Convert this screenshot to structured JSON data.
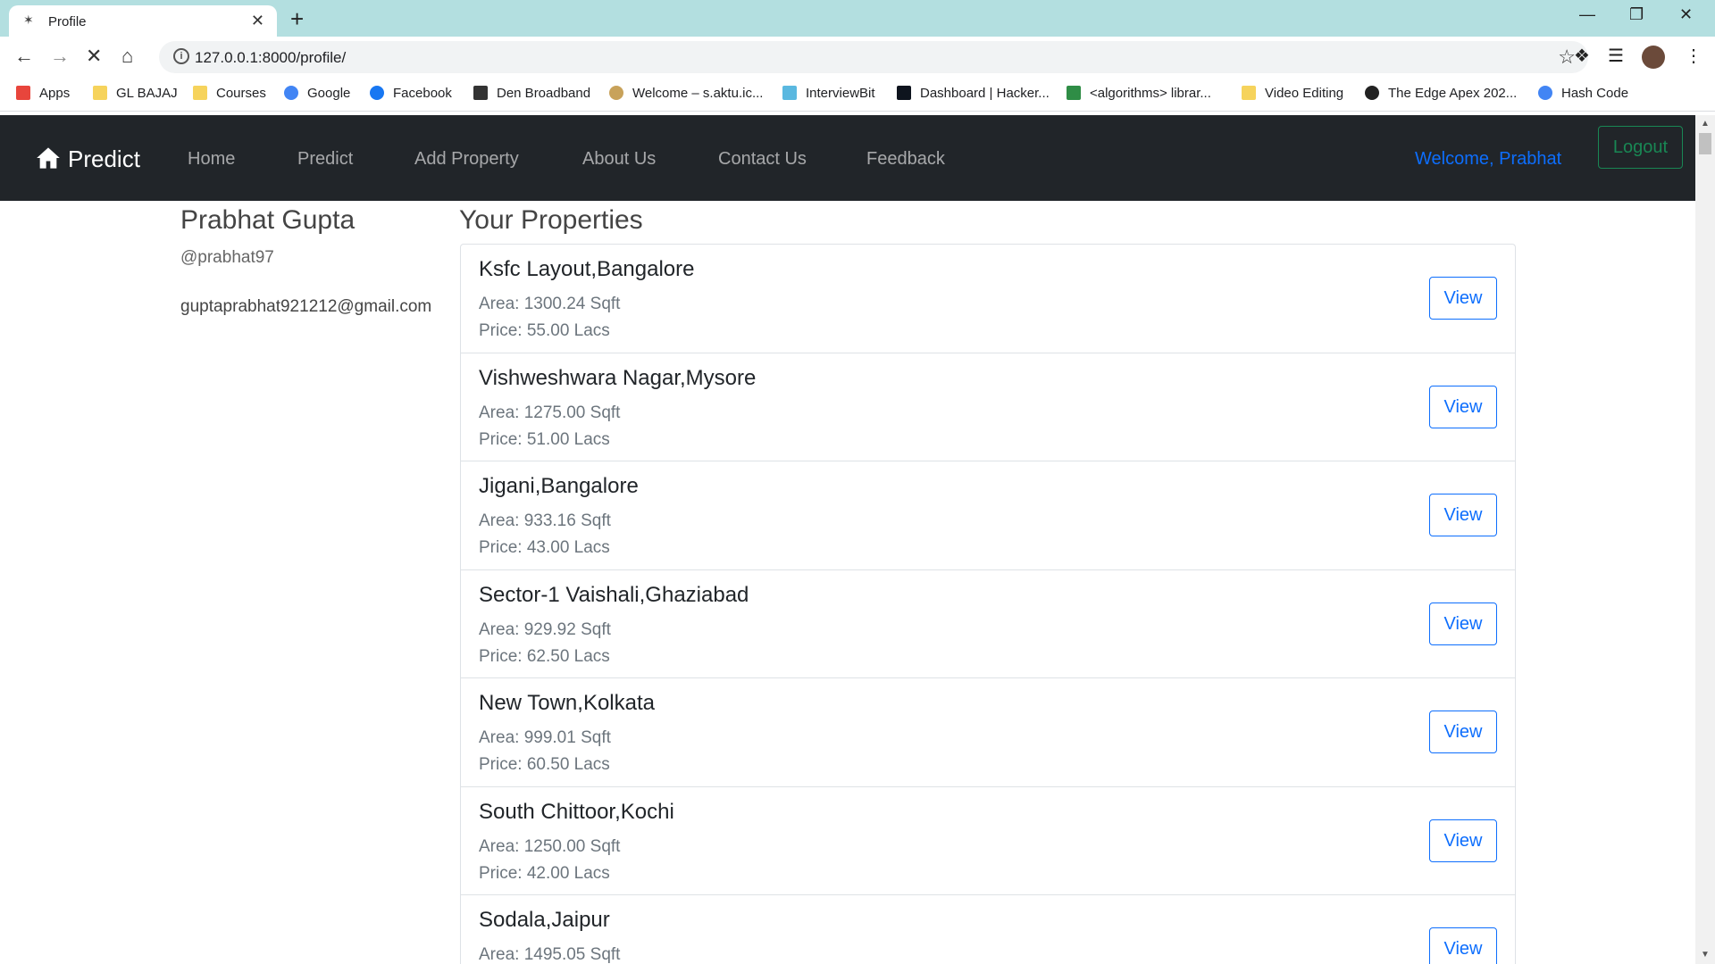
{
  "browser": {
    "tab_title": "Profile",
    "new_tab_glyph": "+",
    "url": "127.0.0.1:8000/profile/",
    "bookmarks": [
      {
        "label": "Apps",
        "icon": "apps-grid-icon"
      },
      {
        "label": "GL BAJAJ",
        "icon": "folder-icon"
      },
      {
        "label": "Courses",
        "icon": "folder-icon"
      },
      {
        "label": "Google",
        "icon": "google-icon"
      },
      {
        "label": "Facebook",
        "icon": "facebook-icon"
      },
      {
        "label": "Den Broadband",
        "icon": "den-icon"
      },
      {
        "label": "Welcome – s.aktu.ic...",
        "icon": "aktu-icon"
      },
      {
        "label": "InterviewBit",
        "icon": "interviewbit-icon"
      },
      {
        "label": "Dashboard | Hacker...",
        "icon": "hackerrank-icon"
      },
      {
        "label": "<algorithms> librar...",
        "icon": "gfg-icon"
      },
      {
        "label": "Video Editing",
        "icon": "folder-icon"
      },
      {
        "label": "The Edge Apex 202...",
        "icon": "globe-icon"
      },
      {
        "label": "Hash Code",
        "icon": "google-icon"
      }
    ]
  },
  "navbar": {
    "brand": "Predict",
    "links": [
      "Home",
      "Predict",
      "Add Property",
      "About Us",
      "Contact Us",
      "Feedback"
    ],
    "welcome": "Welcome, Prabhat",
    "logout": "Logout"
  },
  "profile": {
    "name": "Prabhat Gupta",
    "handle": "@prabhat97",
    "email": "guptaprabhat921212@gmail.com"
  },
  "properties": {
    "title": "Your Properties",
    "view_label": "View",
    "items": [
      {
        "title": "Ksfc Layout,Bangalore",
        "area": "Area: 1300.24 Sqft",
        "price": "Price: 55.00 Lacs"
      },
      {
        "title": "Vishweshwara Nagar,Mysore",
        "area": "Area: 1275.00 Sqft",
        "price": "Price: 51.00 Lacs"
      },
      {
        "title": "Jigani,Bangalore",
        "area": "Area: 933.16 Sqft",
        "price": "Price: 43.00 Lacs"
      },
      {
        "title": "Sector-1 Vaishali,Ghaziabad",
        "area": "Area: 929.92 Sqft",
        "price": "Price: 62.50 Lacs"
      },
      {
        "title": "New Town,Kolkata",
        "area": "Area: 999.01 Sqft",
        "price": "Price: 60.50 Lacs"
      },
      {
        "title": "South Chittoor,Kochi",
        "area": "Area: 1250.00 Sqft",
        "price": "Price: 42.00 Lacs"
      },
      {
        "title": "Sodala,Jaipur",
        "area": "Area: 1495.05 Sqft",
        "price": ""
      }
    ]
  },
  "colors": {
    "tabstrip": "#b3dfe0",
    "navbar": "#212529",
    "primary": "#0d6efd",
    "success": "#198754"
  }
}
